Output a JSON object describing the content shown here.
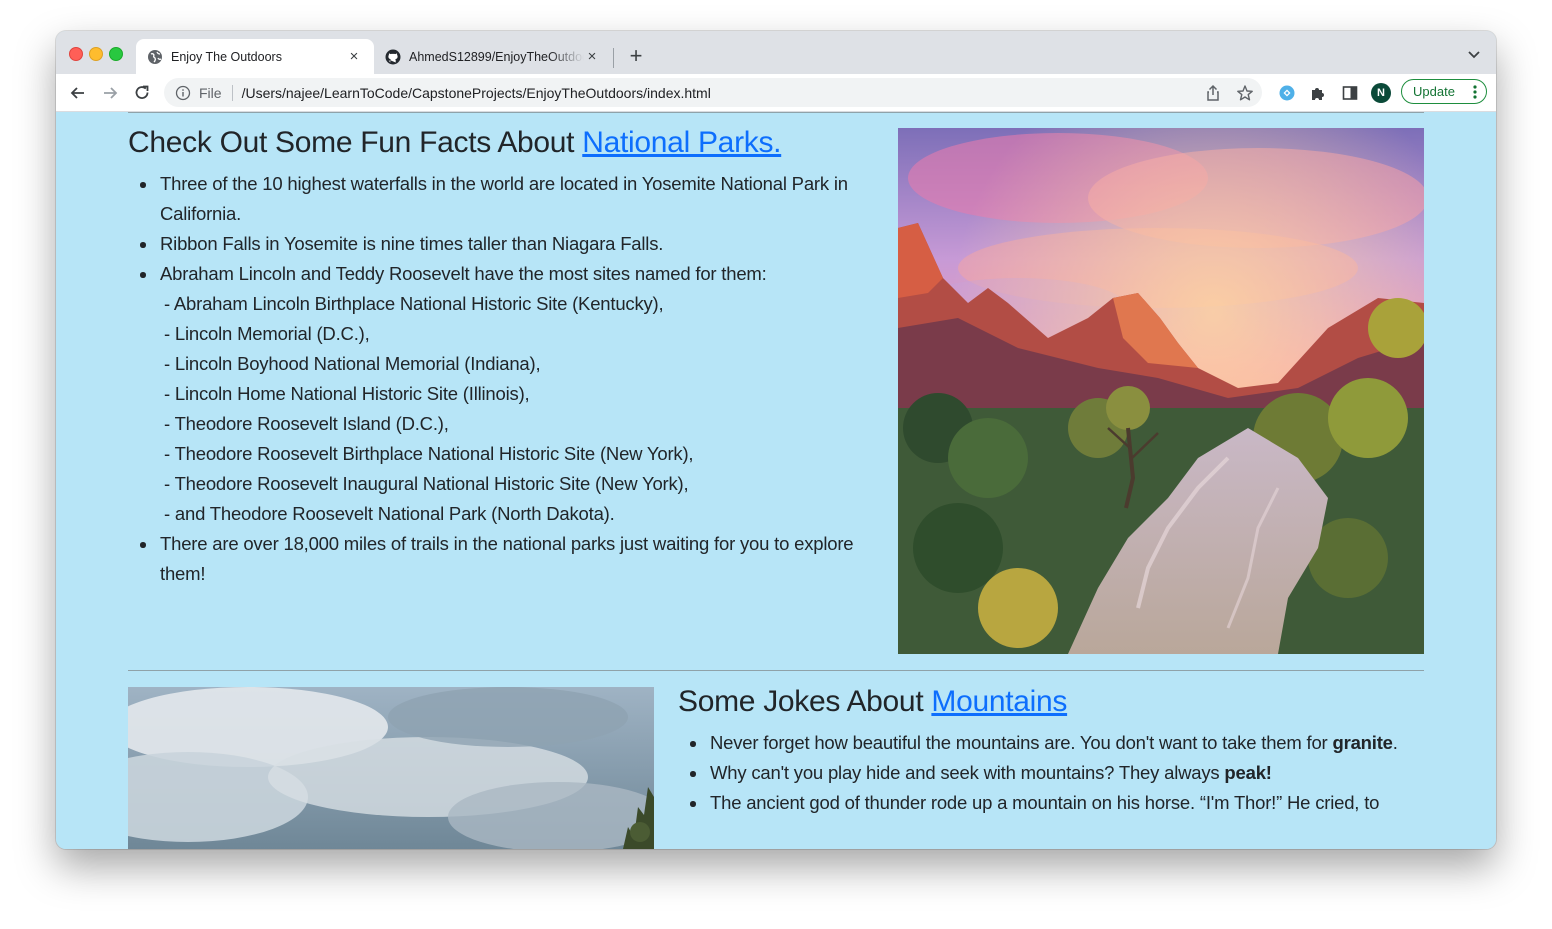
{
  "browser": {
    "tabs": [
      {
        "title": "Enjoy The Outdoors",
        "active": true
      },
      {
        "title": "AhmedS12899/EnjoyTheOutdoors",
        "active": false
      }
    ],
    "new_tab_label": "+",
    "close_label": "×",
    "address": {
      "scheme": "File",
      "url": "/Users/najee/LearnToCode/CapstoneProjects/EnjoyTheOutdoors/index.html"
    },
    "profile_initial": "N",
    "update_label": "Update"
  },
  "section1": {
    "heading_prefix": "Check Out Some Fun Facts About ",
    "heading_link": "National Parks.",
    "facts": [
      "Three of the 10 highest waterfalls in the world are located in Yosemite National Park in California.",
      "Ribbon Falls in Yosemite is nine times taller than Niagara Falls.",
      "Abraham Lincoln and Teddy Roosevelt have the most sites named for them:",
      "There are over 18,000 miles of trails in the national parks just waiting for you to explore them!"
    ],
    "sites": [
      "- Abraham Lincoln Birthplace National Historic Site (Kentucky),",
      "- Lincoln Memorial (D.C.),",
      "- Lincoln Boyhood National Memorial (Indiana),",
      "- Lincoln Home National Historic Site (Illinois),",
      "- Theodore Roosevelt Island (D.C.),",
      "- Theodore Roosevelt Birthplace National Historic Site (New York),",
      "- Theodore Roosevelt Inaugural National Historic Site (New York),",
      "- and Theodore Roosevelt National Park (North Dakota)."
    ]
  },
  "section2": {
    "heading_prefix": "Some Jokes About ",
    "heading_link": "Mountains",
    "joke1_text": "Never forget how beautiful the mountains are. You don't want to take them for ",
    "joke1_bold": "granite",
    "joke1_end": ".",
    "joke2_text": "Why can't you play hide and seek with mountains? They always ",
    "joke2_bold": "peak!",
    "joke3_text": "The ancient god of thunder rode up a mountain on his horse. “I'm Thor!” He cried, to"
  },
  "colors": {
    "page_background": "#b7e5f7",
    "link": "#0d6efd",
    "text": "#212529",
    "update_green": "#137333"
  },
  "icons": [
    "globe-icon",
    "github-icon",
    "close-icon",
    "plus-icon",
    "chevron-down-icon",
    "back-arrow-icon",
    "forward-arrow-icon",
    "reload-icon",
    "info-icon",
    "share-icon",
    "star-icon",
    "extension-icon",
    "puzzle-icon",
    "side-panel-icon",
    "kebab-menu-icon"
  ]
}
